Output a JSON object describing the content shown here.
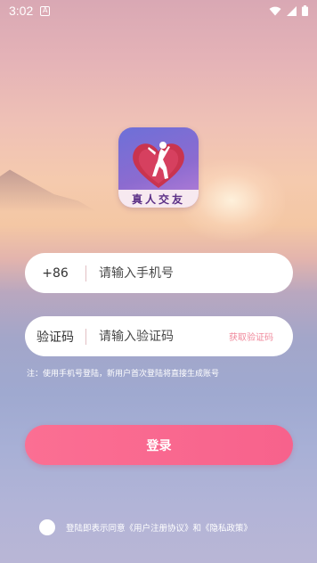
{
  "status_bar": {
    "time": "3:02",
    "notification_badge": "A",
    "icons": [
      "wifi-icon",
      "signal-icon",
      "battery-icon"
    ]
  },
  "app": {
    "logo_label": "真人交友"
  },
  "phone_field": {
    "prefix": "+86",
    "placeholder": "请输入手机号",
    "value": ""
  },
  "code_field": {
    "label": "验证码",
    "placeholder": "请输入验证码",
    "value": "",
    "get_code_label": "获取验证码"
  },
  "hint": "注：使用手机号登陆，新用户首次登陆将直接生成账号",
  "login_button": "登录",
  "agreement": {
    "checked": false,
    "text": "登陆即表示同意《用户注册协议》和《隐私政策》"
  },
  "colors": {
    "accent": "#f96a90",
    "link": "#f08a9c",
    "logo_text": "#5b2f86"
  }
}
